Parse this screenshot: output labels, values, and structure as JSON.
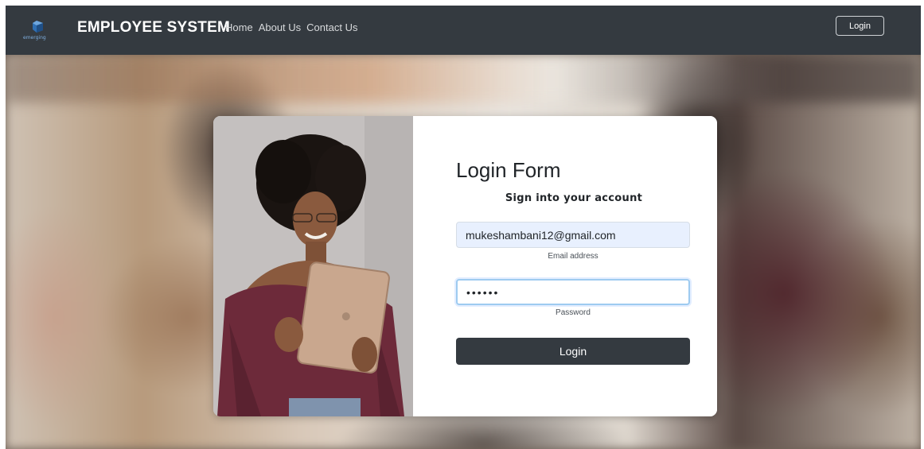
{
  "navbar": {
    "logo_icon": "emerging-logo-icon",
    "logo_text": "emerging",
    "brand": "EMPLOYEE SYSTEM",
    "links": [
      "Home",
      "About Us",
      "Contact Us"
    ],
    "login_button": "Login",
    "background": "#343a40"
  },
  "form": {
    "title": "Login Form",
    "subtitle": "Sign into your account",
    "email_value": "mukeshambani12@gmail.com",
    "email_label": "Email address",
    "password_value": "••••••",
    "password_label": "Password",
    "submit_label": "Login"
  },
  "colors": {
    "accent_dark": "#343a40",
    "autofill_bg": "#e8f0fe",
    "focus_border": "#9ecbf0"
  }
}
